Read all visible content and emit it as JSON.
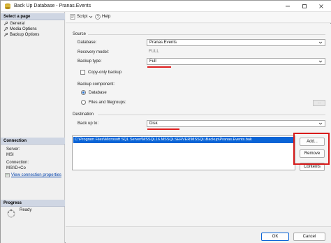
{
  "window": {
    "title": "Back Up Database - Pranas.Events",
    "controls": [
      "minimize-icon",
      "maximize-icon",
      "close-icon"
    ]
  },
  "left_pane": {
    "select_page_heading": "Select a page",
    "pages": [
      {
        "label": "General",
        "icon": "wrench-icon"
      },
      {
        "label": "Media Options",
        "icon": "wrench-icon"
      },
      {
        "label": "Backup Options",
        "icon": "wrench-icon"
      }
    ],
    "connection_heading": "Connection",
    "server_label": "Server:",
    "server_value": "MSI",
    "connection_label": "Connection:",
    "connection_value": "MSI\\D+Co",
    "view_connection_link": "View connection properties",
    "progress_heading": "Progress",
    "progress_status": "Ready"
  },
  "toolbar": {
    "script_label": "Script",
    "help_label": "Help"
  },
  "form": {
    "source_label": "Source",
    "database_label": "Database:",
    "database_value": "Pranas.Events",
    "recovery_model_label": "Recovery model:",
    "recovery_model_value": "FULL",
    "backup_type_label": "Backup type:",
    "backup_type_value": "Full",
    "copy_only_label": "Copy-only backup",
    "backup_component_label": "Backup component:",
    "component_database_label": "Database",
    "component_files_label": "Files and filegroups:",
    "ellipsis_label": "...",
    "destination_label": "Destination",
    "back_up_to_label": "Back up to:",
    "back_up_to_value": "Disk",
    "destination_paths": [
      "C:\\Program Files\\Microsoft SQL Server\\MSSQL16.MSSQLSERVER\\MSSQL\\Backup\\Pranas.Events.bak"
    ],
    "add_button": "Add...",
    "remove_button": "Remove",
    "contents_button": "Contents"
  },
  "footer": {
    "ok_button": "OK",
    "cancel_button": "Cancel"
  },
  "colors": {
    "accent": "#0a64d6",
    "highlight_red": "#e01e1e",
    "section_header": "#cfd6e3"
  }
}
